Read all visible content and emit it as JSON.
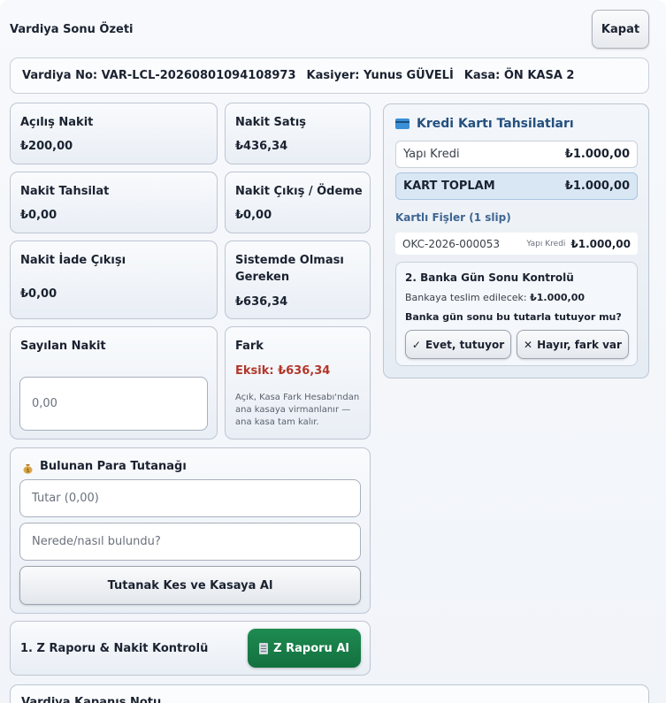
{
  "window": {
    "title": "Vardiya Sonu Özeti",
    "close_label": "Kapat"
  },
  "info": {
    "vardiya_no": "Vardiya No: VAR-LCL-20260801094108973",
    "kasiyer": "Kasiyer: Yunus GÜVELİ",
    "kasa": "Kasa: ÖN KASA 2"
  },
  "cards": {
    "acilis_nakit": {
      "label": "Açılış Nakit",
      "value": "₺200,00"
    },
    "nakit_satis": {
      "label": "Nakit Satış",
      "value": "₺436,34"
    },
    "nakit_tahsilat": {
      "label": "Nakit Tahsilat",
      "value": "₺0,00"
    },
    "nakit_cikis": {
      "label": "Nakit Çıkış / Ödeme",
      "value": "₺0,00"
    },
    "nakit_iade": {
      "label": "Nakit İade Çıkışı",
      "value": "₺0,00"
    },
    "sistemde": {
      "label_line1": "Sistemde Olması",
      "label_line2": "Gereken",
      "value": "₺636,34"
    },
    "sayilan": {
      "label": "Sayılan Nakit",
      "input_value": "0,00"
    },
    "fark": {
      "label": "Fark",
      "value": "Eksik: ₺636,34",
      "note": "Açık, Kasa Fark Hesabı'ndan ana kasaya virmanlanır — ana kasa tam kalır.",
      "accent": "#b3372b"
    }
  },
  "found_money": {
    "icon": "money-bag-icon",
    "title": "Bulunan Para Tutanağı",
    "amount_placeholder": "Tutar (0,00)",
    "where_placeholder": "Nerede/nasıl bulundu?",
    "button_label": "Tutanak Kes ve Kasaya Al"
  },
  "z_report": {
    "label": "1. Z Raporu & Nakit Kontrolü",
    "button_label": "Z Raporu Al",
    "button_icon": "receipt-icon",
    "button_color": "#1a7e49"
  },
  "next_section": {
    "label": "Vardiya Kapanış Notu"
  },
  "credit": {
    "icon": "credit-card-icon",
    "title": "Kredi Kartı Tahsilatları",
    "rows": [
      {
        "name": "Yapı Kredi",
        "amount": "₺1.000,00"
      }
    ],
    "total_label": "KART TOPLAM",
    "total_value": "₺1.000,00",
    "slips_title": "Kartlı Fişler (1 slip)",
    "slips": [
      {
        "id": "OKC-2026-000053",
        "bank": "Yapı Kredi",
        "amount": "₺1.000,00"
      }
    ]
  },
  "bank_check": {
    "title": "2. Banka Gün Sonu Kontrolü",
    "deliver_label": "Bankaya teslim edilecek:",
    "deliver_value": "₺1.000,00",
    "question": "Banka gün sonu bu tutarla tutuyor mu?",
    "yes_label": "Evet, tutuyor",
    "no_label": "Hayır, fark var"
  }
}
